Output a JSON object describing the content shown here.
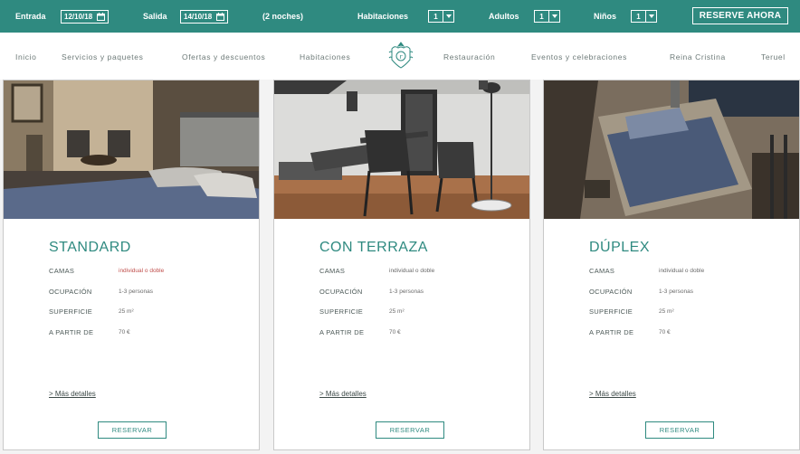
{
  "booking": {
    "checkin_label": "Entrada",
    "checkin_value": "12/10/18",
    "checkout_label": "Salida",
    "checkout_value": "14/10/18",
    "nights": "(2 noches)",
    "rooms_label": "Habitaciones",
    "rooms_value": "1",
    "adults_label": "Adultos",
    "adults_value": "1",
    "children_label": "Niños",
    "children_value": "1",
    "reserve_now": "RESERVE AHORA"
  },
  "nav": {
    "items": [
      {
        "label": "Inicio"
      },
      {
        "label": "Servicios y paquetes"
      },
      {
        "label": "Ofertas y descuentos"
      },
      {
        "label": "Habitaciones"
      },
      {
        "label": "Restauración"
      },
      {
        "label": "Eventos y celebraciones"
      },
      {
        "label": "Reina Cristina"
      },
      {
        "label": "Teruel"
      }
    ]
  },
  "cards": [
    {
      "title": "STANDARD",
      "specs": [
        {
          "label": "CAMAS",
          "value": "individual o doble"
        },
        {
          "label": "OCUPACIÓN",
          "value": "1-3 personas"
        },
        {
          "label": "SUPERFICIE",
          "value": "25 m²"
        },
        {
          "label": "A PARTIR DE",
          "value": "70 €"
        }
      ],
      "details": "> Más detalles",
      "reserve": "RESERVAR"
    },
    {
      "title": "CON TERRAZA",
      "specs": [
        {
          "label": "CAMAS",
          "value": "individual o doble"
        },
        {
          "label": "OCUPACIÓN",
          "value": "1-3 personas"
        },
        {
          "label": "SUPERFICIE",
          "value": "25 m²"
        },
        {
          "label": "A PARTIR DE",
          "value": "70 €"
        }
      ],
      "details": "> Más detalles",
      "reserve": "RESERVAR"
    },
    {
      "title": "DÚPLEX",
      "specs": [
        {
          "label": "CAMAS",
          "value": "individual o doble"
        },
        {
          "label": "OCUPACIÓN",
          "value": "1-3 personas"
        },
        {
          "label": "SUPERFICIE",
          "value": "25 m²"
        },
        {
          "label": "A PARTIR DE",
          "value": "70 €"
        }
      ],
      "details": "> Más detalles",
      "reserve": "RESERVAR"
    }
  ],
  "colors": {
    "brand": "#2f8a80",
    "background": "#f3f3f3"
  }
}
